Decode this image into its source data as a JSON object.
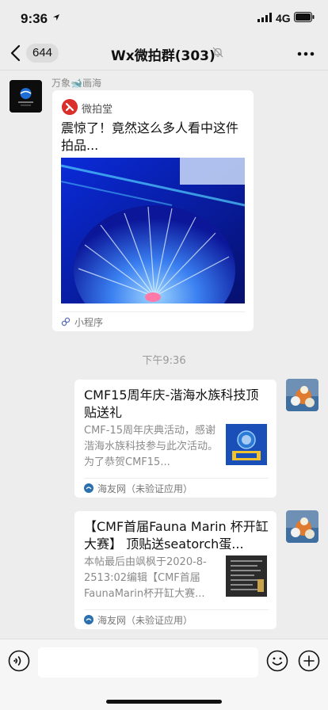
{
  "status_bar": {
    "time": "9:36",
    "network": "4G"
  },
  "nav": {
    "back_count": "644",
    "title": "Wx微拍群(303)"
  },
  "messages": {
    "incoming": {
      "sender": "万象🐋画海",
      "source": "微拍堂",
      "title": "震惊了！竟然这么多人看中这件拍品...",
      "type_label": "小程序"
    },
    "timestamp": "下午9:36",
    "outgoing": [
      {
        "title": "CMF15周年庆-湝海水族科技顶贴送礼",
        "description": "CMF-15周年庆典活动，感谢湝海水族科技参与此次活动。为了恭贺CMF15...",
        "app": "海友网（未验证应用）"
      },
      {
        "title": "【CMF首届Fauna Marin 杯开缸大赛】 顶贴送seatorch蛋...",
        "description": "本帖最后由飒枫于2020-8-2513:02编辑【CMF首届FaunaMarin杯开缸大赛...",
        "app": "海友网（未验证应用）"
      }
    ]
  },
  "input_bar": {
    "text_value": ""
  },
  "colors": {
    "background": "#ededed",
    "card": "#ffffff",
    "muted_text": "#8a8a8a",
    "brand_red": "#d9302b"
  },
  "icons": {
    "back": "chevron-left-icon",
    "mute": "bell-mute-icon",
    "more": "more-dots-icon",
    "voice": "voice-icon",
    "emoji": "emoji-icon",
    "plus": "plus-icon"
  }
}
